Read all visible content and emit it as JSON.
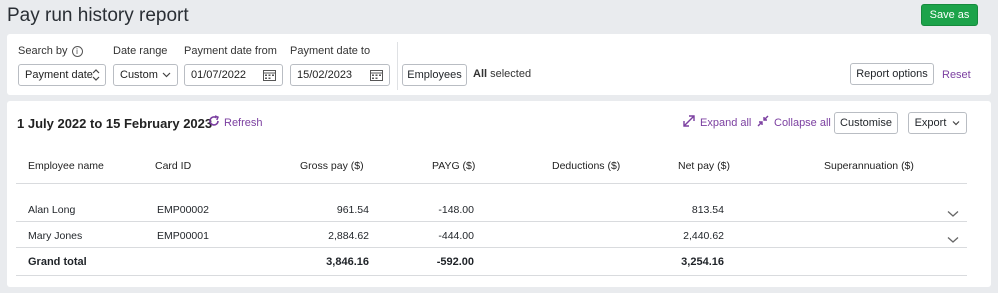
{
  "header": {
    "title": "Pay run history report",
    "save_as_label": "Save as"
  },
  "filters": {
    "search_by": {
      "label": "Search by",
      "value": "Payment date"
    },
    "date_range": {
      "label": "Date range",
      "value": "Custom"
    },
    "payment_date_from": {
      "label": "Payment date from",
      "value": "01/07/2022"
    },
    "payment_date_to": {
      "label": "Payment date to",
      "value": "15/02/2023"
    },
    "employees_button": "Employees",
    "all_selected_bold": "All",
    "all_selected_rest": "selected",
    "report_options_label": "Report options",
    "reset_label": "Reset"
  },
  "report": {
    "date_range_title": "1 July 2022 to 15 February 2023",
    "refresh_label": "Refresh",
    "expand_all_label": "Expand all",
    "collapse_all_label": "Collapse all",
    "customise_label": "Customise",
    "export_label": "Export",
    "columns": [
      "Employee name",
      "Card ID",
      "Gross pay ($)",
      "PAYG ($)",
      "Deductions ($)",
      "Net pay ($)",
      "Superannuation ($)"
    ],
    "rows": [
      {
        "name": "Alan Long",
        "card_id": "EMP00002",
        "gross": "961.54",
        "payg": "-148.00",
        "deductions": "",
        "net": "813.54",
        "super": ""
      },
      {
        "name": "Mary Jones",
        "card_id": "EMP00001",
        "gross": "2,884.62",
        "payg": "-444.00",
        "deductions": "",
        "net": "2,440.62",
        "super": ""
      }
    ],
    "total": {
      "label": "Grand total",
      "gross": "3,846.16",
      "payg": "-592.00",
      "deductions": "",
      "net": "3,254.16",
      "super": ""
    }
  },
  "colors": {
    "accent_purple": "#7b3fa0",
    "save_green": "#1ca34a",
    "background": "#e9ebee"
  }
}
